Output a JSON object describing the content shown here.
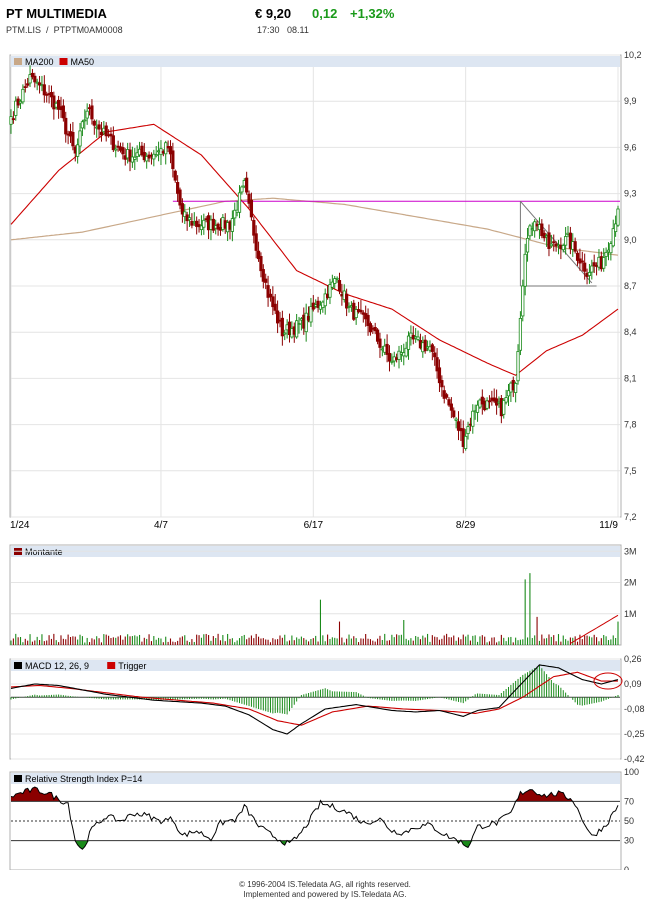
{
  "header": {
    "name": "PT MULTIMEDIA",
    "symbol": "PTM.LIS",
    "separator": "/",
    "isin": "PTPTM0AM0008",
    "price": "€ 9,20",
    "change": "0,12",
    "change_pct": "+1,32%",
    "time": "17:30",
    "date": "08.11"
  },
  "colors": {
    "up": "#1a8a1a",
    "down": "#8b0000",
    "ma200": "#c8a888",
    "ma50": "#cc0000",
    "resistance": "#cc00cc",
    "legend_bg": "#dde6f2",
    "grid": "#e4e4e4"
  },
  "chart_data": [
    {
      "type": "candlestick",
      "legend": [
        "MA200",
        "MA50"
      ],
      "x_ticks": [
        "1/24",
        "4/7",
        "6/17",
        "8/29",
        "11/9"
      ],
      "y_ticks": [
        "10,2",
        "9,9",
        "9,6",
        "9,3",
        "9,0",
        "8,7",
        "8,4",
        "8,1",
        "7,8",
        "7,5",
        "7,2"
      ],
      "ylim": [
        7.2,
        10.2
      ],
      "grid": true,
      "close_anchors": [
        [
          0,
          9.8
        ],
        [
          8,
          10.05
        ],
        [
          15,
          9.95
        ],
        [
          20,
          9.85
        ],
        [
          27,
          9.55
        ],
        [
          32,
          9.85
        ],
        [
          38,
          9.7
        ],
        [
          48,
          9.55
        ],
        [
          58,
          9.55
        ],
        [
          66,
          9.6
        ],
        [
          72,
          9.15
        ],
        [
          78,
          9.1
        ],
        [
          92,
          9.1
        ],
        [
          98,
          9.35
        ],
        [
          104,
          8.9
        ],
        [
          108,
          8.65
        ],
        [
          114,
          8.4
        ],
        [
          122,
          8.45
        ],
        [
          130,
          8.6
        ],
        [
          137,
          8.75
        ],
        [
          142,
          8.55
        ],
        [
          150,
          8.45
        ],
        [
          160,
          8.2
        ],
        [
          168,
          8.35
        ],
        [
          176,
          8.3
        ],
        [
          182,
          8.0
        ],
        [
          190,
          7.7
        ],
        [
          196,
          7.95
        ],
        [
          206,
          7.9
        ],
        [
          212,
          8.1
        ],
        [
          216,
          8.95
        ],
        [
          220,
          9.15
        ],
        [
          226,
          8.95
        ],
        [
          234,
          9.0
        ],
        [
          242,
          8.8
        ],
        [
          248,
          8.85
        ],
        [
          252,
          9.02
        ],
        [
          255,
          9.2
        ]
      ],
      "ma50_anchors": [
        [
          0,
          9.1
        ],
        [
          20,
          9.45
        ],
        [
          40,
          9.7
        ],
        [
          60,
          9.75
        ],
        [
          80,
          9.55
        ],
        [
          100,
          9.2
        ],
        [
          120,
          8.8
        ],
        [
          140,
          8.65
        ],
        [
          160,
          8.55
        ],
        [
          180,
          8.35
        ],
        [
          200,
          8.2
        ],
        [
          212,
          8.12
        ],
        [
          225,
          8.28
        ],
        [
          240,
          8.38
        ],
        [
          255,
          8.55
        ]
      ],
      "ma200_anchors": [
        [
          0,
          9.0
        ],
        [
          30,
          9.05
        ],
        [
          60,
          9.15
        ],
        [
          90,
          9.25
        ],
        [
          110,
          9.27
        ],
        [
          140,
          9.23
        ],
        [
          170,
          9.15
        ],
        [
          200,
          9.07
        ],
        [
          230,
          8.95
        ],
        [
          255,
          8.9
        ]
      ],
      "resistance_level": 9.25,
      "triangle": {
        "apex": [
          214,
          9.25
        ],
        "upper_end": [
          244,
          8.72
        ],
        "lower_y": 8.7,
        "range": [
          214,
          246
        ]
      }
    },
    {
      "type": "bar",
      "legend": [
        "Montante"
      ],
      "y_ticks": [
        "3M",
        "2M",
        "1M"
      ],
      "ylim": [
        0,
        3.2
      ],
      "units": "millions",
      "spikes": [
        [
          130,
          1.45
        ],
        [
          138,
          0.75
        ],
        [
          165,
          0.8
        ],
        [
          216,
          2.1
        ],
        [
          218,
          2.3
        ],
        [
          221,
          0.9
        ],
        [
          246,
          0.25
        ],
        [
          255,
          0.75
        ]
      ]
    },
    {
      "type": "line",
      "legend": [
        "MACD 12, 26, 9",
        "Trigger"
      ],
      "y_ticks": [
        "0,26",
        "0,09",
        "-0,08",
        "-0,25",
        "-0,42"
      ],
      "ylim": [
        -0.42,
        0.26
      ],
      "macd_anchors": [
        [
          0,
          0.06
        ],
        [
          10,
          0.09
        ],
        [
          20,
          0.08
        ],
        [
          30,
          0.05
        ],
        [
          40,
          0.02
        ],
        [
          50,
          0.0
        ],
        [
          60,
          -0.02
        ],
        [
          70,
          -0.03
        ],
        [
          80,
          -0.04
        ],
        [
          90,
          -0.06
        ],
        [
          100,
          -0.12
        ],
        [
          110,
          -0.22
        ],
        [
          116,
          -0.25
        ],
        [
          122,
          -0.18
        ],
        [
          132,
          -0.08
        ],
        [
          145,
          -0.05
        ],
        [
          160,
          -0.09
        ],
        [
          170,
          -0.1
        ],
        [
          180,
          -0.09
        ],
        [
          190,
          -0.13
        ],
        [
          196,
          -0.09
        ],
        [
          205,
          -0.07
        ],
        [
          212,
          0.05
        ],
        [
          222,
          0.22
        ],
        [
          230,
          0.2
        ],
        [
          240,
          0.12
        ],
        [
          248,
          0.09
        ],
        [
          255,
          0.12
        ]
      ],
      "signal_anchors": [
        [
          0,
          0.07
        ],
        [
          12,
          0.08
        ],
        [
          25,
          0.06
        ],
        [
          40,
          0.03
        ],
        [
          55,
          0.0
        ],
        [
          70,
          -0.02
        ],
        [
          85,
          -0.04
        ],
        [
          100,
          -0.08
        ],
        [
          112,
          -0.16
        ],
        [
          122,
          -0.19
        ],
        [
          135,
          -0.1
        ],
        [
          150,
          -0.06
        ],
        [
          165,
          -0.08
        ],
        [
          180,
          -0.09
        ],
        [
          195,
          -0.11
        ],
        [
          205,
          -0.08
        ],
        [
          215,
          0.0
        ],
        [
          228,
          0.14
        ],
        [
          238,
          0.17
        ],
        [
          248,
          0.11
        ],
        [
          255,
          0.11
        ]
      ]
    },
    {
      "type": "line",
      "legend": [
        "Relative Strength Index P=14"
      ],
      "y_ticks": [
        "100",
        "70",
        "50",
        "30",
        "0"
      ],
      "ylim": [
        0,
        100
      ],
      "levels": [
        70,
        50,
        30
      ],
      "rsi_anchors": [
        [
          0,
          75
        ],
        [
          6,
          80
        ],
        [
          10,
          82
        ],
        [
          16,
          78
        ],
        [
          20,
          72
        ],
        [
          24,
          68
        ],
        [
          27,
          30
        ],
        [
          30,
          20
        ],
        [
          34,
          42
        ],
        [
          40,
          55
        ],
        [
          46,
          50
        ],
        [
          52,
          58
        ],
        [
          58,
          55
        ],
        [
          62,
          50
        ],
        [
          68,
          52
        ],
        [
          72,
          35
        ],
        [
          78,
          40
        ],
        [
          84,
          32
        ],
        [
          88,
          48
        ],
        [
          95,
          52
        ],
        [
          98,
          65
        ],
        [
          104,
          45
        ],
        [
          108,
          38
        ],
        [
          112,
          32
        ],
        [
          117,
          26
        ],
        [
          122,
          38
        ],
        [
          130,
          68
        ],
        [
          136,
          64
        ],
        [
          142,
          58
        ],
        [
          148,
          48
        ],
        [
          155,
          52
        ],
        [
          160,
          40
        ],
        [
          165,
          38
        ],
        [
          170,
          44
        ],
        [
          176,
          46
        ],
        [
          182,
          36
        ],
        [
          188,
          30
        ],
        [
          192,
          24
        ],
        [
          196,
          44
        ],
        [
          204,
          48
        ],
        [
          210,
          58
        ],
        [
          214,
          78
        ],
        [
          218,
          83
        ],
        [
          224,
          76
        ],
        [
          230,
          78
        ],
        [
          236,
          72
        ],
        [
          240,
          52
        ],
        [
          244,
          34
        ],
        [
          250,
          46
        ],
        [
          255,
          66
        ]
      ]
    }
  ],
  "footer": {
    "line1": "© 1996-2004 IS.Teledata AG, all rights reserved.",
    "line2": "Implemented and powered by IS.Teledata AG."
  }
}
